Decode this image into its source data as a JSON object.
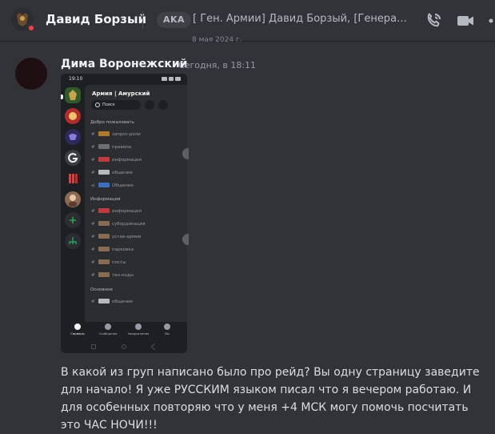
{
  "header": {
    "user_name": "Давид Борзый",
    "aka_label": "AKA",
    "nicknames": "[ Ген. Армии] Давид Борзый, [Генерал Арми...",
    "icons": {
      "call": "phone-icon",
      "video": "video-camera-icon",
      "more": "more-icon"
    },
    "status_color": "#f23f43"
  },
  "date_divider_fragment": "8 мая 2024 г.",
  "message": {
    "author": "Дима Воронежский",
    "timestamp": "Сегодня, в 18:11",
    "text": "В какой из груп написано было про рейд? Вы одну страницу заведите для начало! Я уже РУССКИМ языком писал что я вечером работаю. И для особенных повторяю что у меня +4 МСК могу помочь посчитать это ЧАС НОЧИ!!!"
  },
  "attachment": {
    "phone_time": "19:10",
    "server_name": "Армия | Амурский",
    "search_label": "Поиск",
    "categories": [
      {
        "name": "Добро пожаловать",
        "channels": [
          "запрос-роли",
          "правила",
          "информация",
          "общение",
          "Общение"
        ]
      },
      {
        "name": "Информация",
        "channels": [
          "информация",
          "субординация",
          "устав-армии",
          "парковка",
          "посты",
          "тен-коды"
        ]
      },
      {
        "name": "Основное",
        "channels": [
          "общение"
        ]
      }
    ],
    "tabs": [
      "Серверы",
      "Сообщения",
      "Уведомления",
      "Вы"
    ]
  },
  "colors": {
    "background": "#313338",
    "text": "#dbdee1",
    "author": "#f2f3f5",
    "muted": "#949ba4"
  }
}
